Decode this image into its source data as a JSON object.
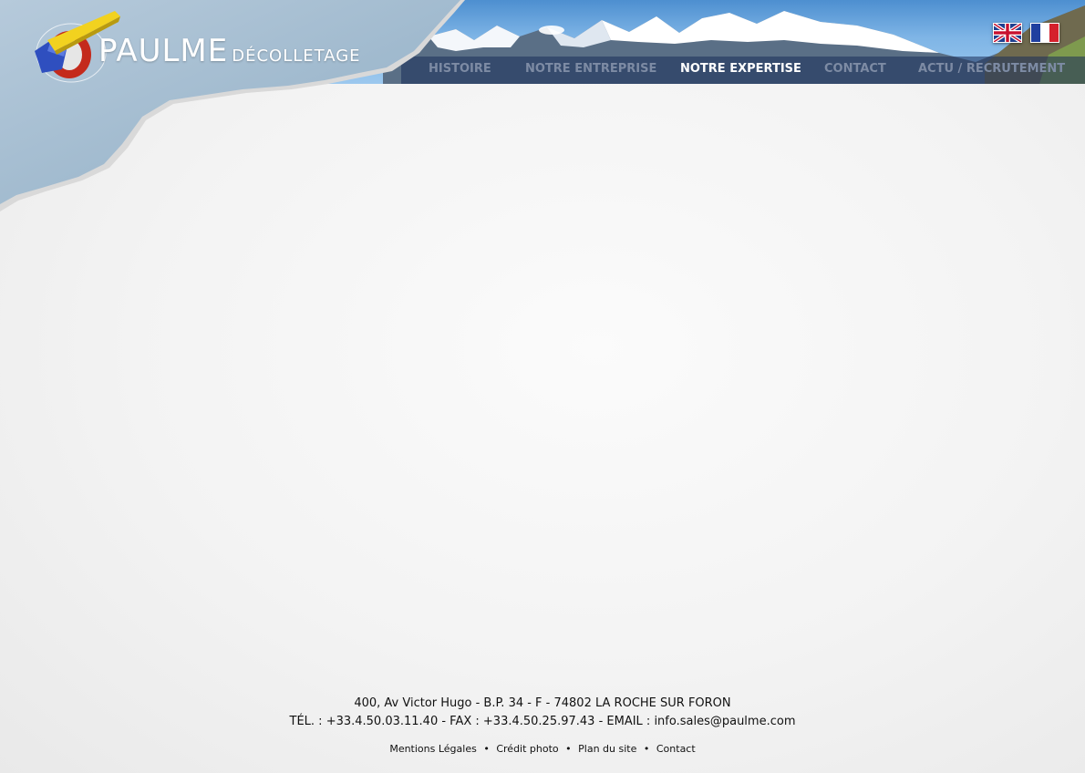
{
  "brand": {
    "name": "PAULME",
    "subtitle": "DÉCOLLETAGE"
  },
  "nav": {
    "items": [
      {
        "label": "HISTOIRE",
        "active": false
      },
      {
        "label": "NOTRE ENTREPRISE",
        "active": false
      },
      {
        "label": "NOTRE EXPERTISE",
        "active": true
      },
      {
        "label": "CONTACT",
        "active": false
      },
      {
        "label": "ACTU / RECRUTEMENT",
        "active": false
      }
    ]
  },
  "languages": [
    "english-flag-icon",
    "french-flag-icon"
  ],
  "footer": {
    "address_line": "400, Av Victor Hugo - B.P. 34 - F - 74802 LA ROCHE SUR FORON",
    "contact_line": "TÉL. : +33.4.50.03.11.40  - FAX : +33.4.50.25.97.43 - EMAIL : info.sales@paulme.com",
    "links": [
      "Mentions Légales",
      "Crédit photo",
      "Plan du site",
      "Contact"
    ],
    "separator": "•"
  },
  "colors": {
    "sky": "#4d8fd0",
    "paper": "#9fbad0",
    "nav_inactive": "#7d8ba4",
    "nav_active": "#ffffff"
  }
}
